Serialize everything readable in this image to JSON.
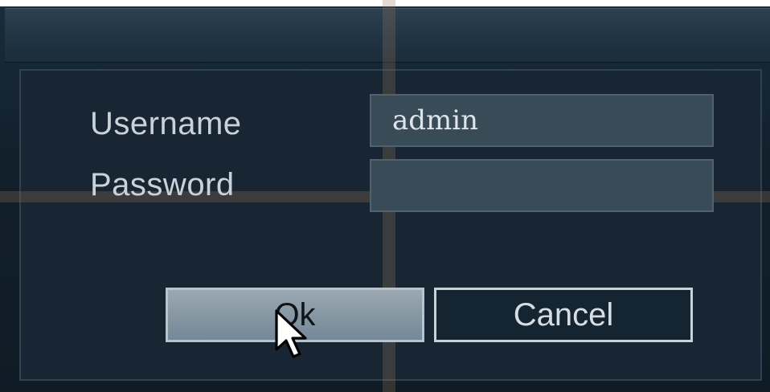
{
  "login_dialog": {
    "username_label": "Username",
    "password_label": "Password",
    "username_value": "admin",
    "password_value": "",
    "ok_label": "Ok",
    "cancel_label": "Cancel"
  },
  "icons": {
    "pointer": "mouse-pointer-icon"
  },
  "colors": {
    "panel_background": "#182633",
    "field_background": "#3a4b58",
    "ok_button": "#8596a2",
    "label_text": "#c9d2d8"
  }
}
